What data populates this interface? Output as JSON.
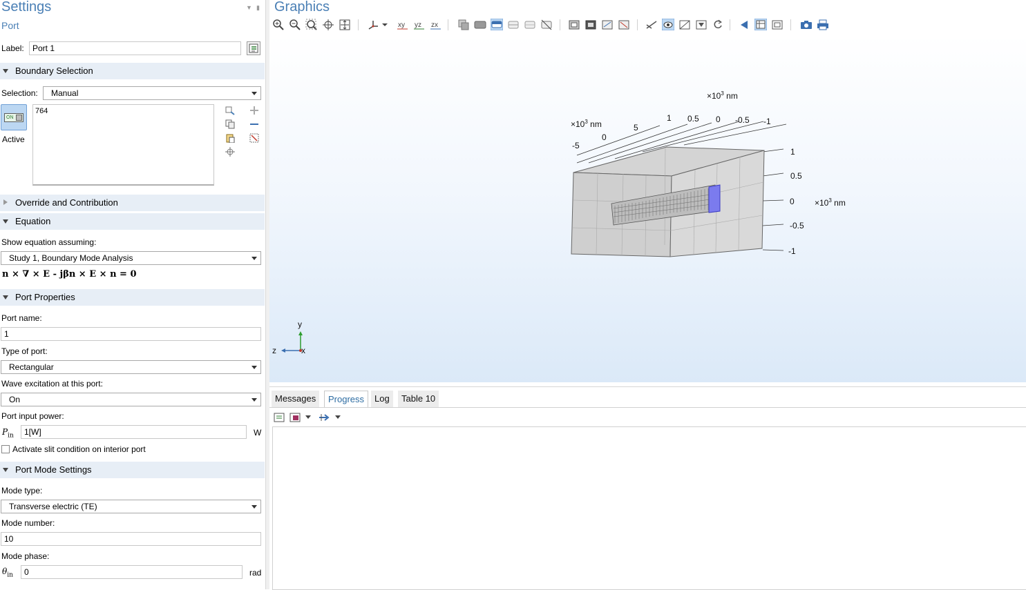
{
  "settings": {
    "title": "Settings",
    "subtitle": "Port",
    "label_caption": "Label:",
    "label_value": "Port 1",
    "boundary_selection": {
      "header": "Boundary Selection",
      "selection_caption": "Selection:",
      "selection_value": "Manual",
      "items": "764",
      "active_toggle": "ON",
      "active_label": "Active"
    },
    "override_header": "Override and Contribution",
    "equation": {
      "header": "Equation",
      "show_caption": "Show equation assuming:",
      "study_value": "Study 1, Boundary Mode Analysis",
      "formula": "n × ∇ × E - jβn × E × n = 0"
    },
    "port_properties": {
      "header": "Port Properties",
      "port_name_caption": "Port name:",
      "port_name_value": "1",
      "type_caption": "Type of port:",
      "type_value": "Rectangular",
      "wave_caption": "Wave excitation at this port:",
      "wave_value": "On",
      "power_caption": "Port input power:",
      "power_symbol": "P",
      "power_sub": "in",
      "power_value": "1[W]",
      "power_unit": "W",
      "slit_label": "Activate slit condition on interior port"
    },
    "port_mode": {
      "header": "Port Mode Settings",
      "mode_type_caption": "Mode type:",
      "mode_type_value": "Transverse electric (TE)",
      "mode_number_caption": "Mode number:",
      "mode_number_value": "10",
      "mode_phase_caption": "Mode phase:",
      "phase_symbol": "θ",
      "phase_sub": "in",
      "phase_value": "0",
      "phase_unit": "rad"
    }
  },
  "graphics": {
    "title": "Graphics",
    "axis_labels": {
      "top_scale": "×10³ nm",
      "top_ticks": [
        "1",
        "0.5",
        "0",
        "-0.5",
        "-1"
      ],
      "left_scale": "×10³ nm",
      "left_ticks": [
        "5",
        "0",
        "-5"
      ],
      "right_ticks": [
        "1",
        "0.5",
        "0",
        "-0.5",
        "-1"
      ],
      "right_scale": "×10³ nm"
    },
    "triad": {
      "y": "y",
      "z": "z",
      "x": "x"
    }
  },
  "bottom": {
    "tabs": [
      "Messages",
      "Progress",
      "Log",
      "Table 10"
    ],
    "active_tab": "Progress"
  },
  "colors": {
    "accent": "#4a7fb5",
    "section_bg": "#e7eef6",
    "selection_highlight": "#7b7bee"
  }
}
